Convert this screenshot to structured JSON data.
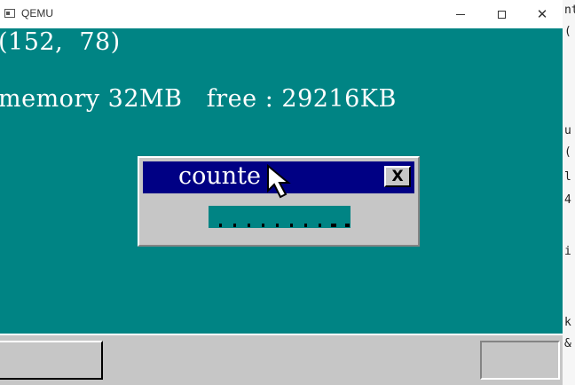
{
  "window": {
    "title": "QEMU",
    "icon": "qemu-app-icon",
    "controls": {
      "minimize": "minimize-icon",
      "maximize": "maximize-icon",
      "close": "close-icon"
    }
  },
  "guest": {
    "mouse_coords": "(152,  78)",
    "memory_line": "memory 32MB   free : 29216KB",
    "background_color": "#008484"
  },
  "counter_window": {
    "title": "counte",
    "close_label": "X",
    "title_bar_color": "#000084",
    "body_color": "#c6c6c6"
  },
  "taskbar": {
    "color": "#c6c6c6"
  },
  "background_editor": {
    "fragments": [
      "nt",
      "(",
      "u",
      "(",
      "l",
      "4",
      "i",
      "k",
      "&"
    ]
  }
}
